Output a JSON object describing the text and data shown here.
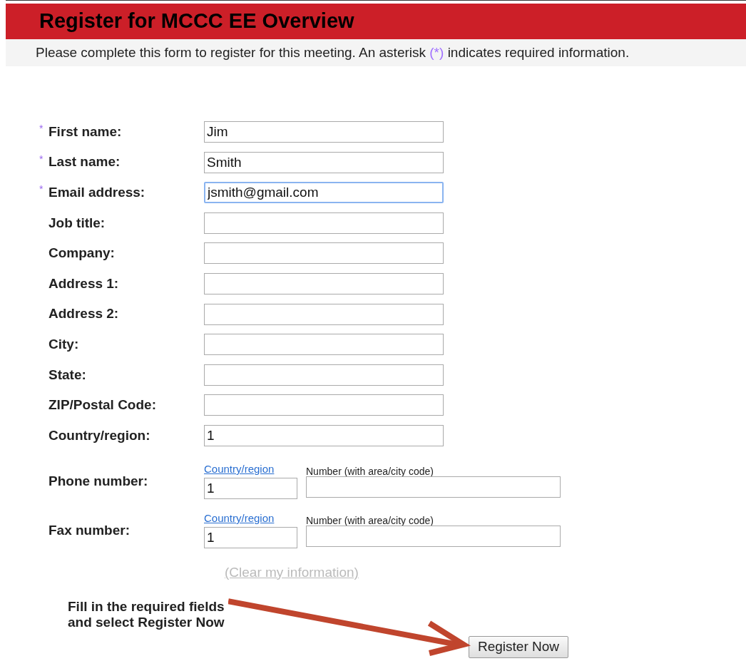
{
  "header": {
    "title": "Register for MCCC EE Overview"
  },
  "intro": {
    "before": "Please complete this form to register for this meeting. An asterisk ",
    "mark": "(*)",
    "after": " indicates required information."
  },
  "fields": [
    {
      "kind": "text",
      "label": "First name:",
      "required_mark": "*",
      "value": "Jim",
      "focused": false
    },
    {
      "kind": "text",
      "label": "Last name:",
      "required_mark": "*",
      "value": "Smith",
      "focused": false
    },
    {
      "kind": "text",
      "label": "Email address:",
      "required_mark": "*",
      "value": "jsmith@gmail.com",
      "focused": true
    },
    {
      "kind": "text",
      "label": "Job title:",
      "focused": false
    },
    {
      "kind": "text",
      "label": "Company:",
      "focused": false
    },
    {
      "kind": "text",
      "label": "Address 1:",
      "focused": false
    },
    {
      "kind": "text",
      "label": "Address 2:",
      "focused": false
    },
    {
      "kind": "text",
      "label": "City:",
      "focused": false
    },
    {
      "kind": "text",
      "label": "State:",
      "focused": false
    },
    {
      "kind": "text",
      "label": "ZIP/Postal Code:",
      "focused": false
    },
    {
      "kind": "text",
      "label": "Country/region:",
      "value": "1",
      "focused": false
    },
    {
      "kind": "phone",
      "label": "Phone number:",
      "code_link": "Country/region",
      "number_label": "Number (with area/city code)",
      "code_value": "1"
    },
    {
      "kind": "phone",
      "label": "Fax number:",
      "code_link": "Country/region",
      "number_label": "Number (with area/city code)",
      "code_value": "1"
    }
  ],
  "clear_link": "(Clear my information)",
  "annotation": [
    "Fill in the required fields",
    "and select Register Now"
  ],
  "submit_button": "Register Now"
}
